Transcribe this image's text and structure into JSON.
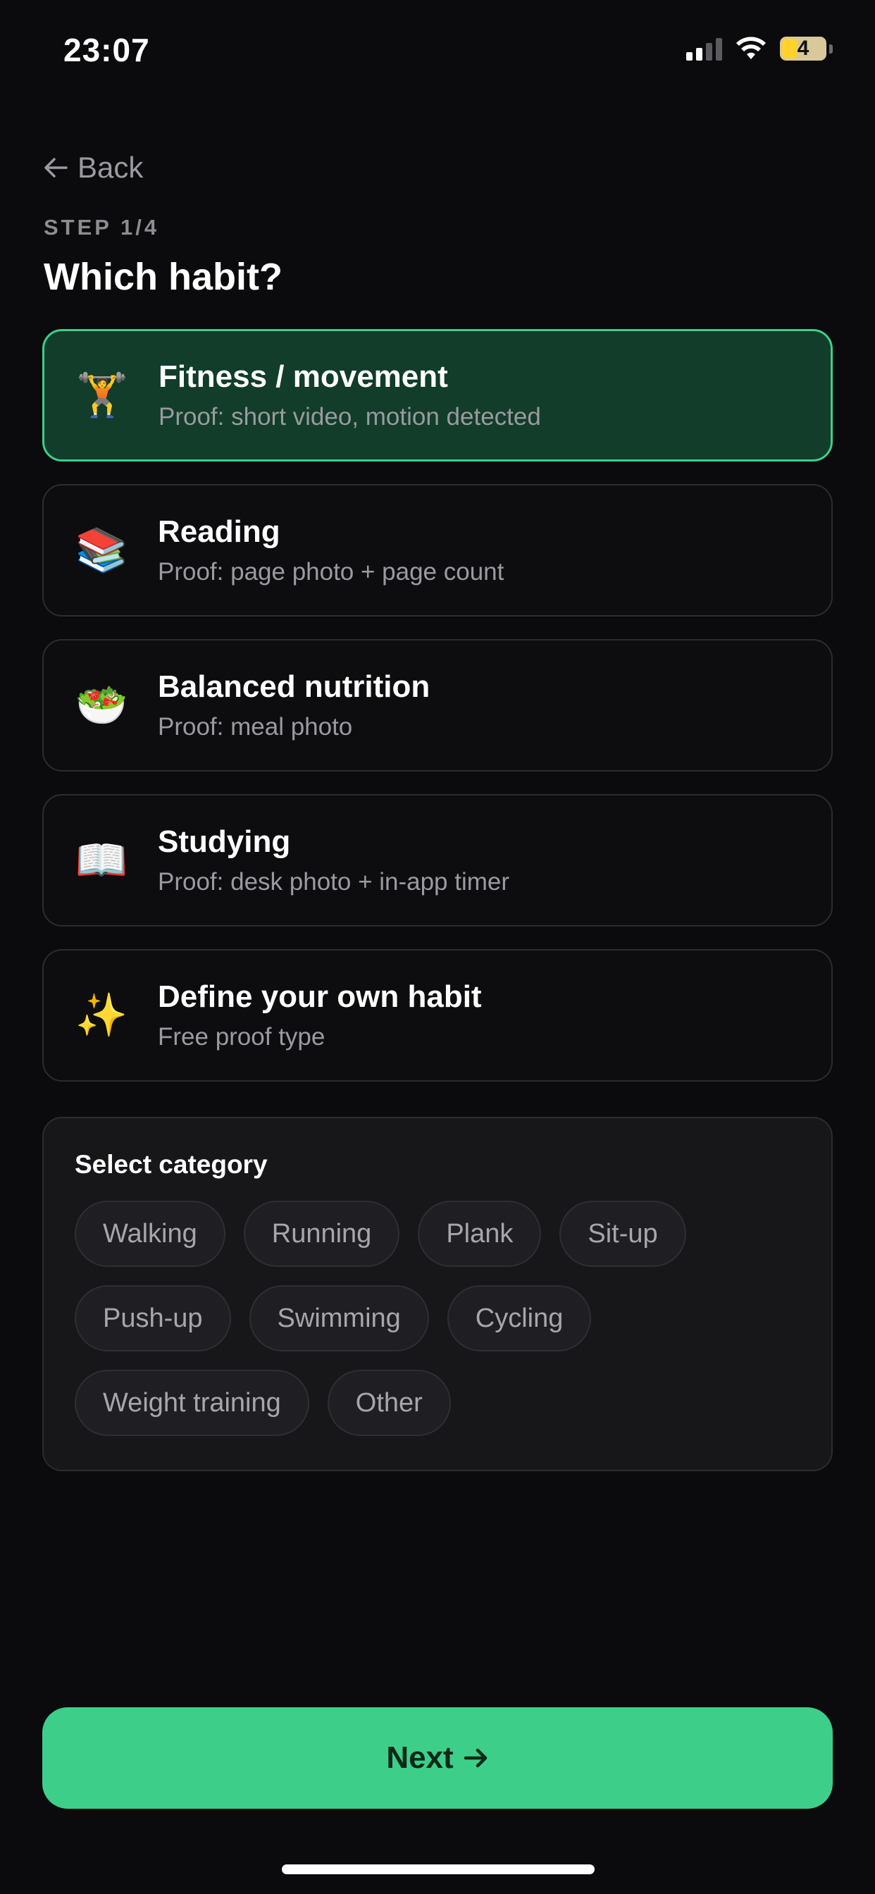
{
  "status_bar": {
    "time": "23:07",
    "battery": "4"
  },
  "header": {
    "back_label": "Back",
    "step": "STEP 1/4",
    "title": "Which habit?"
  },
  "habits": [
    {
      "icon": "weightlifter-icon",
      "emoji": "🏋️",
      "title": "Fitness / movement",
      "proof": "Proof: short video, motion detected",
      "selected": true
    },
    {
      "icon": "books-icon",
      "emoji": "📚",
      "title": "Reading",
      "proof": "Proof: page photo + page count",
      "selected": false
    },
    {
      "icon": "salad-icon",
      "emoji": "🥗",
      "title": "Balanced nutrition",
      "proof": "Proof: meal photo",
      "selected": false
    },
    {
      "icon": "open-book-icon",
      "emoji": "📖",
      "title": "Studying",
      "proof": "Proof: desk photo + in-app timer",
      "selected": false
    },
    {
      "icon": "sparkles-icon",
      "emoji": "✨",
      "title": "Define your own habit",
      "proof": "Free proof type",
      "selected": false
    }
  ],
  "category_panel": {
    "title": "Select category",
    "chips": [
      "Walking",
      "Running",
      "Plank",
      "Sit-up",
      "Push-up",
      "Swimming",
      "Cycling",
      "Weight training",
      "Other"
    ]
  },
  "footer": {
    "next_label": "Next"
  },
  "colors": {
    "accent": "#3dcf8a",
    "selected_card_bg": "#113d2a",
    "background": "#0b0b0d"
  }
}
